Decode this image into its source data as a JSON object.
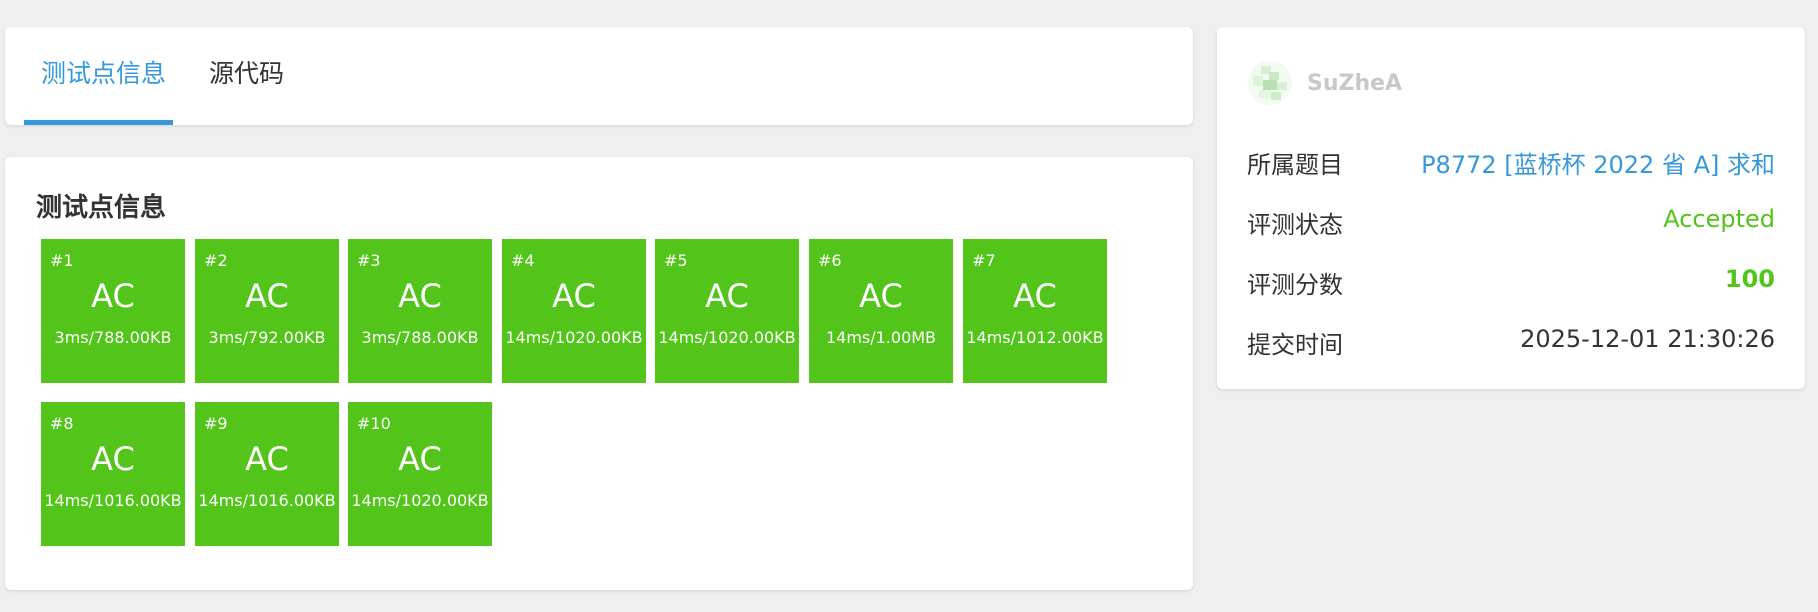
{
  "tabs": [
    {
      "label": "测试点信息"
    },
    {
      "label": "源代码"
    }
  ],
  "section_title": "测试点信息",
  "testcases": [
    {
      "num": "#1",
      "status": "AC",
      "detail": "3ms/788.00KB"
    },
    {
      "num": "#2",
      "status": "AC",
      "detail": "3ms/792.00KB"
    },
    {
      "num": "#3",
      "status": "AC",
      "detail": "3ms/788.00KB"
    },
    {
      "num": "#4",
      "status": "AC",
      "detail": "14ms/1020.00KB"
    },
    {
      "num": "#5",
      "status": "AC",
      "detail": "14ms/1020.00KB"
    },
    {
      "num": "#6",
      "status": "AC",
      "detail": "14ms/1.00MB"
    },
    {
      "num": "#7",
      "status": "AC",
      "detail": "14ms/1012.00KB"
    },
    {
      "num": "#8",
      "status": "AC",
      "detail": "14ms/1016.00KB"
    },
    {
      "num": "#9",
      "status": "AC",
      "detail": "14ms/1016.00KB"
    },
    {
      "num": "#10",
      "status": "AC",
      "detail": "14ms/1020.00KB"
    }
  ],
  "user": {
    "name": "SuZheA"
  },
  "info": {
    "problem_label": "所属题目",
    "problem_value": "P8772 [蓝桥杯 2022 省 A] 求和",
    "status_label": "评测状态",
    "status_value": "Accepted",
    "score_label": "评测分数",
    "score_value": "100",
    "time_label": "提交时间",
    "time_value": "2025-12-01 21:30:26"
  },
  "colors": {
    "accent": "#3498db",
    "ac_green": "#52c41a",
    "background": "#efefef"
  }
}
